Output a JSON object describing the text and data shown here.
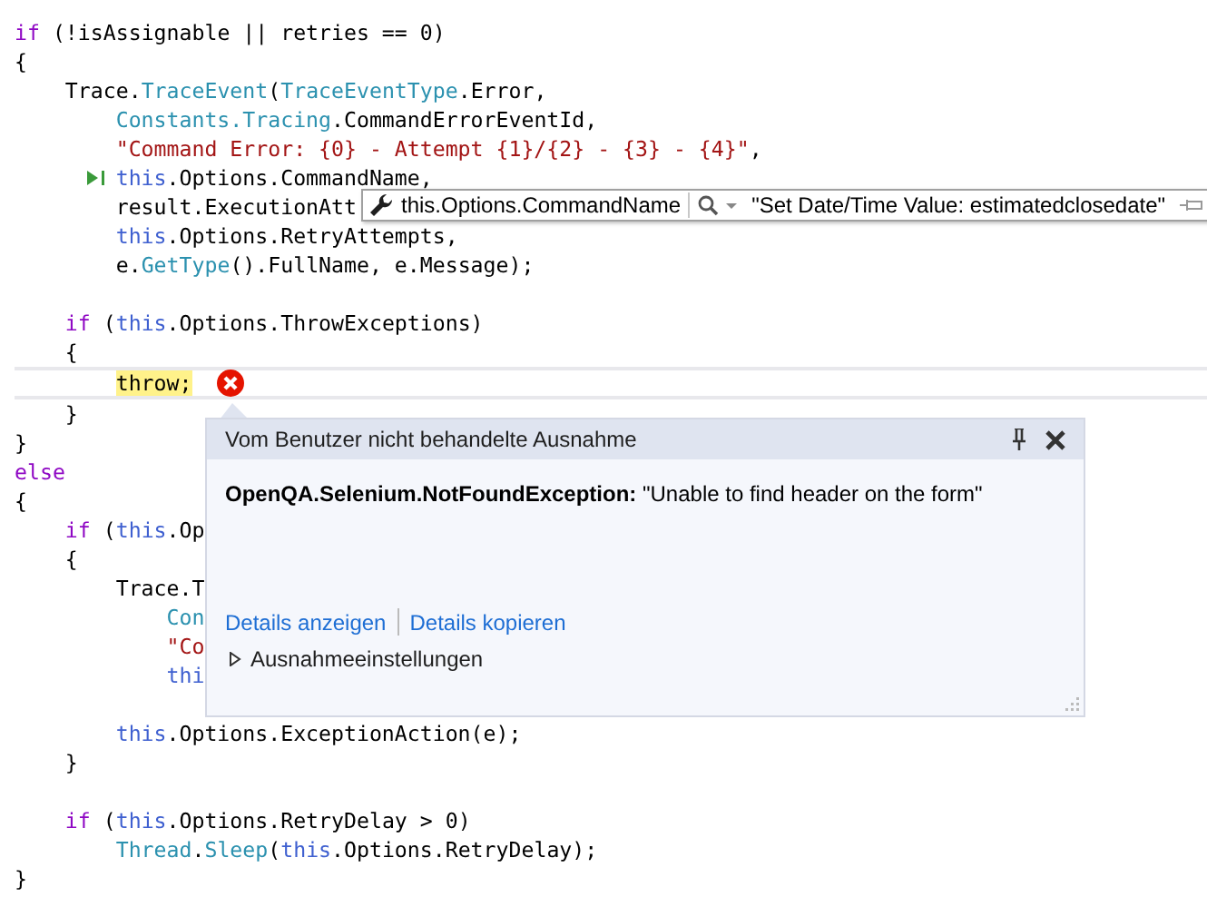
{
  "code": {
    "lines": [
      {
        "kind": "code",
        "tokens": [
          {
            "kind": "kw",
            "text": "if"
          },
          {
            "kind": "plain",
            "text": " (!isAssignable || retries == 0)"
          }
        ]
      },
      {
        "kind": "code",
        "tokens": [
          {
            "kind": "plain",
            "text": "{"
          }
        ]
      },
      {
        "kind": "code",
        "tokens": [
          {
            "kind": "plain",
            "text": "    Trace."
          },
          {
            "kind": "type",
            "text": "TraceEvent"
          },
          {
            "kind": "plain",
            "text": "("
          },
          {
            "kind": "type",
            "text": "TraceEventType"
          },
          {
            "kind": "plain",
            "text": ".Error,"
          }
        ]
      },
      {
        "kind": "code",
        "tokens": [
          {
            "kind": "type",
            "text": "        Constants.Tracing"
          },
          {
            "kind": "plain",
            "text": ".CommandErrorEventId,"
          }
        ]
      },
      {
        "kind": "code",
        "tokens": [
          {
            "kind": "str",
            "text": "        \"Command Error: {0} - Attempt {1}/{2} - {3} - {4}\""
          },
          {
            "kind": "plain",
            "text": ","
          }
        ]
      },
      {
        "kind": "code",
        "run_to_click": true,
        "tokens": [
          {
            "kind": "this",
            "text": "        this"
          },
          {
            "kind": "plain",
            "text": ".Options.CommandName,"
          }
        ]
      },
      {
        "kind": "code",
        "tokens": [
          {
            "kind": "plain",
            "text": "        result.ExecutionAtt"
          }
        ]
      },
      {
        "kind": "code",
        "tokens": [
          {
            "kind": "this",
            "text": "        this"
          },
          {
            "kind": "plain",
            "text": ".Options.RetryAttempts,"
          }
        ]
      },
      {
        "kind": "code",
        "tokens": [
          {
            "kind": "plain",
            "text": "        e."
          },
          {
            "kind": "type",
            "text": "GetType"
          },
          {
            "kind": "plain",
            "text": "().FullName, e.Message);"
          }
        ]
      },
      {
        "kind": "blank"
      },
      {
        "kind": "code",
        "tokens": [
          {
            "kind": "kw",
            "text": "    if"
          },
          {
            "kind": "plain",
            "text": " ("
          },
          {
            "kind": "this",
            "text": "this"
          },
          {
            "kind": "plain",
            "text": ".Options.ThrowExceptions)"
          }
        ]
      },
      {
        "kind": "code",
        "tokens": [
          {
            "kind": "plain",
            "text": "    {"
          }
        ]
      },
      {
        "kind": "code",
        "current": true,
        "error": true,
        "tokens": [
          {
            "kind": "current",
            "text": "        throw;"
          }
        ]
      },
      {
        "kind": "code",
        "tokens": [
          {
            "kind": "plain",
            "text": "    }"
          }
        ]
      },
      {
        "kind": "code",
        "tokens": [
          {
            "kind": "plain",
            "text": "}"
          }
        ]
      },
      {
        "kind": "code",
        "tokens": [
          {
            "kind": "kw",
            "text": "else"
          }
        ]
      },
      {
        "kind": "code",
        "tokens": [
          {
            "kind": "plain",
            "text": "{"
          }
        ]
      },
      {
        "kind": "code",
        "tokens": [
          {
            "kind": "kw",
            "text": "    if"
          },
          {
            "kind": "plain",
            "text": " ("
          },
          {
            "kind": "this",
            "text": "this"
          },
          {
            "kind": "plain",
            "text": ".Op"
          }
        ]
      },
      {
        "kind": "code",
        "tokens": [
          {
            "kind": "plain",
            "text": "    {"
          }
        ]
      },
      {
        "kind": "code",
        "tokens": [
          {
            "kind": "plain",
            "text": "        Trace.T"
          }
        ]
      },
      {
        "kind": "code",
        "tokens": [
          {
            "kind": "type",
            "text": "            Con"
          }
        ]
      },
      {
        "kind": "code",
        "tokens": [
          {
            "kind": "str",
            "text": "            \"Co"
          }
        ]
      },
      {
        "kind": "code",
        "tokens": [
          {
            "kind": "this",
            "text": "            thi"
          }
        ]
      },
      {
        "kind": "blank"
      },
      {
        "kind": "code",
        "tokens": [
          {
            "kind": "this",
            "text": "        this"
          },
          {
            "kind": "plain",
            "text": ".Options.ExceptionAction(e);"
          }
        ]
      },
      {
        "kind": "code",
        "tokens": [
          {
            "kind": "plain",
            "text": "    }"
          }
        ]
      },
      {
        "kind": "blank"
      },
      {
        "kind": "code",
        "tokens": [
          {
            "kind": "kw",
            "text": "    if"
          },
          {
            "kind": "plain",
            "text": " ("
          },
          {
            "kind": "this",
            "text": "this"
          },
          {
            "kind": "plain",
            "text": ".Options.RetryDelay > 0)"
          }
        ]
      },
      {
        "kind": "code",
        "tokens": [
          {
            "kind": "type",
            "text": "        Thread"
          },
          {
            "kind": "plain",
            "text": "."
          },
          {
            "kind": "type",
            "text": "Sleep"
          },
          {
            "kind": "plain",
            "text": "("
          },
          {
            "kind": "this",
            "text": "this"
          },
          {
            "kind": "plain",
            "text": ".Options.RetryDelay);"
          }
        ]
      },
      {
        "kind": "code",
        "tokens": [
          {
            "kind": "plain",
            "text": "}"
          }
        ]
      }
    ]
  },
  "datatip": {
    "expression": "this.Options.CommandName",
    "value": "\"Set Date/Time Value: estimatedclosedate\""
  },
  "exception_popup": {
    "title": "Vom Benutzer nicht behandelte Ausnahme",
    "message": "**OpenQA.Selenium.NotFoundException:** \"Unable to find header on the form\"",
    "links": [
      "Details anzeigen",
      "Details kopieren"
    ],
    "settings": {
      "label": "Ausnahmeeinstellungen",
      "expanded": false
    }
  }
}
